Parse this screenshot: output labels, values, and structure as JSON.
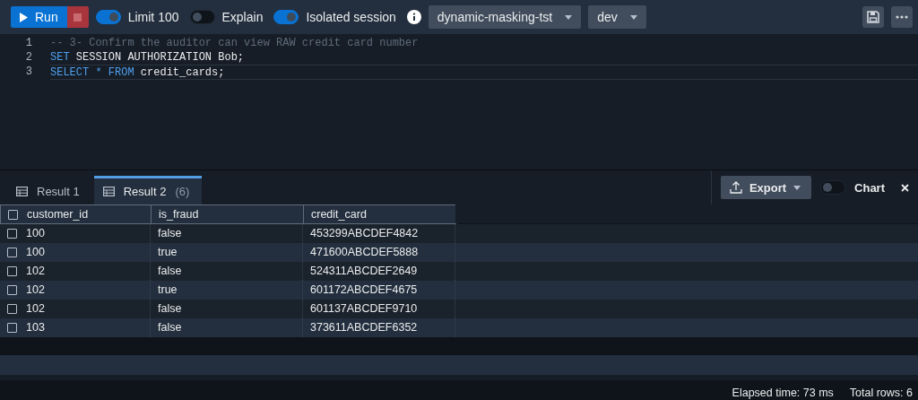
{
  "toolbar": {
    "run_label": "Run",
    "toggles": [
      {
        "label": "Limit 100",
        "on": true
      },
      {
        "label": "Explain",
        "on": false
      },
      {
        "label": "Isolated session",
        "on": true
      }
    ],
    "dropdowns": [
      {
        "value": "dynamic-masking-tst"
      },
      {
        "value": "dev"
      }
    ]
  },
  "editor": {
    "lines": [
      {
        "number": "1",
        "tokens": [
          {
            "kind": "comment",
            "text": "-- 3- Confirm the auditor can view RAW credit card number"
          }
        ]
      },
      {
        "number": "2",
        "tokens": [
          {
            "kind": "keyword",
            "text": "SET"
          },
          {
            "kind": "plain",
            "text": " SESSION AUTHORIZATION Bob;"
          }
        ]
      },
      {
        "number": "3",
        "tokens": [
          {
            "kind": "keyword",
            "text": "SELECT"
          },
          {
            "kind": "operator",
            "text": " * "
          },
          {
            "kind": "keyword",
            "text": "FROM"
          },
          {
            "kind": "plain",
            "text": " credit_cards;"
          }
        ]
      }
    ]
  },
  "results": {
    "tabs": [
      {
        "label": "Result 1",
        "selected": false
      },
      {
        "label": "Result 2",
        "count": "(6)",
        "selected": true
      }
    ],
    "export_label": "Export",
    "chart": {
      "label": "Chart",
      "on": false
    },
    "table": {
      "header_checked": false,
      "columns": [
        "customer_id",
        "is_fraud",
        "credit_card"
      ],
      "rows": [
        {
          "checked": false,
          "cells": [
            "100",
            "false",
            "453299ABCDEF4842"
          ]
        },
        {
          "checked": false,
          "cells": [
            "100",
            "true",
            "471600ABCDEF5888"
          ]
        },
        {
          "checked": false,
          "cells": [
            "102",
            "false",
            "524311ABCDEF2649"
          ]
        },
        {
          "checked": false,
          "cells": [
            "102",
            "true",
            "601172ABCDEF4675"
          ]
        },
        {
          "checked": false,
          "cells": [
            "102",
            "false",
            "601137ABCDEF9710"
          ]
        },
        {
          "checked": false,
          "cells": [
            "103",
            "false",
            "373611ABCDEF6352"
          ]
        }
      ]
    }
  },
  "status_bar": {
    "elapsed": "Elapsed time: 73 ms",
    "total": "Total rows: 6"
  }
}
